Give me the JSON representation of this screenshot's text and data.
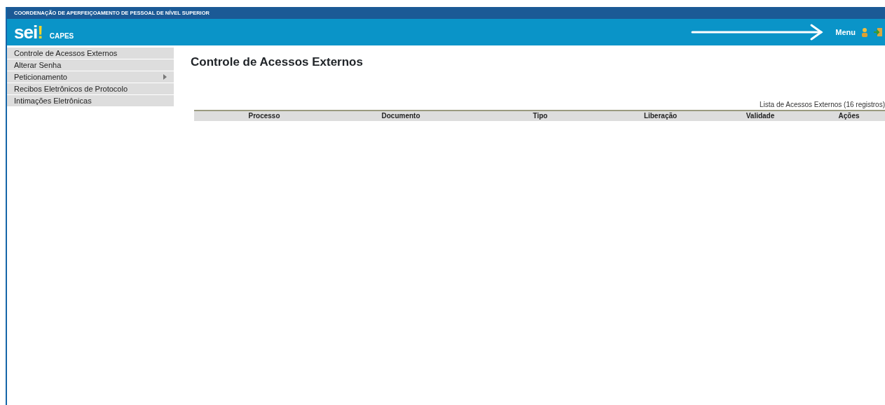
{
  "header": {
    "organization": "COORDENAÇÃO DE APERFEIÇOAMENTO DE PESSOAL DE NÍVEL SUPERIOR",
    "logo": "sei",
    "logo_mark": "!",
    "unit": "CAPES",
    "menu_label": "Menu"
  },
  "sidebar": {
    "items": [
      {
        "label": "Controle de Acessos Externos",
        "has_submenu": false
      },
      {
        "label": "Alterar Senha",
        "has_submenu": false
      },
      {
        "label": "Peticionamento",
        "has_submenu": true
      },
      {
        "label": "Recibos Eletrônicos de Protocolo",
        "has_submenu": false
      },
      {
        "label": "Intimações Eletrônicas",
        "has_submenu": false
      }
    ]
  },
  "page_title": "Controle de Acessos Externos",
  "table": {
    "caption": "Lista de Acessos Externos (16 registros)",
    "columns": [
      "Processo",
      "Documento",
      "Tipo",
      "Liberação",
      "Validade",
      "Ações"
    ]
  }
}
